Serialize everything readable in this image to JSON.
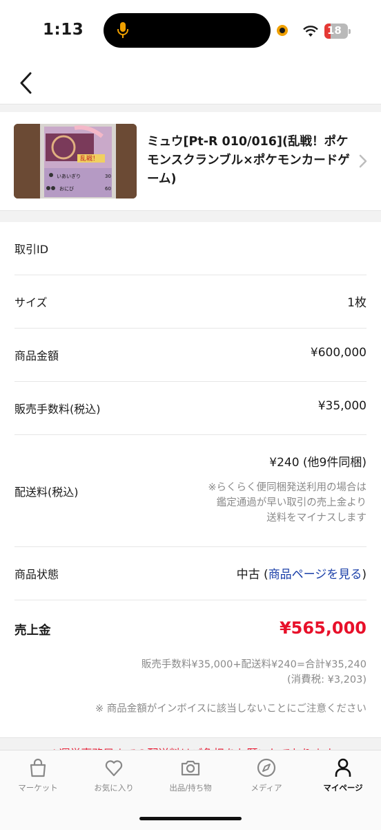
{
  "status_bar": {
    "time": "1:13",
    "battery": "18"
  },
  "product": {
    "title": "ミュウ[Pt-R 010/016](乱戦！ポケモンスクランブル×ポケモンカードゲーム)",
    "card_text": {
      "attack1_name": "いあいぎり",
      "attack1_damage": "30",
      "attack2_name": "おにび",
      "attack2_damage": "60"
    }
  },
  "details": {
    "trade_id_label": "取引ID",
    "size_label": "サイズ",
    "size_value": "1枚",
    "price_label": "商品金額",
    "price_value": "¥600,000",
    "fee_label": "販売手数料(税込)",
    "fee_value": "¥35,000",
    "shipping_label": "配送料(税込)",
    "shipping_value": "¥240 (他9件同梱)",
    "shipping_note_lines": [
      "※らくらく便同梱発送利用の場合は",
      "鑑定通過が早い取引の売上金より",
      "送料をマイナスします"
    ],
    "condition_label": "商品状態",
    "condition_value": "中古",
    "condition_paren_open": "(",
    "condition_link": "商品ページを見る",
    "condition_paren_close": ")",
    "sales_label": "売上金",
    "sales_value": "¥565,000",
    "sales_breakdown": "販売手数料¥35,000+配送料¥240=合計¥35,240",
    "sales_tax": "(消費税: ¥3,203)",
    "invoice_note": "※ 商品金額がインボイスに該当しないことにご注意ください",
    "cut_off_text": "※運営事務局までの配送料はご負担をお願いしております"
  },
  "tabbar": {
    "items": [
      {
        "label": "マーケット",
        "icon": "bag-icon"
      },
      {
        "label": "お気に入り",
        "icon": "heart-icon"
      },
      {
        "label": "出品/持ち物",
        "icon": "camera-icon"
      },
      {
        "label": "メディア",
        "icon": "compass-icon"
      },
      {
        "label": "マイページ",
        "icon": "person-icon",
        "active": true
      }
    ]
  },
  "colors": {
    "accent_red": "#e8102a",
    "link_blue": "#1a3fa8"
  }
}
